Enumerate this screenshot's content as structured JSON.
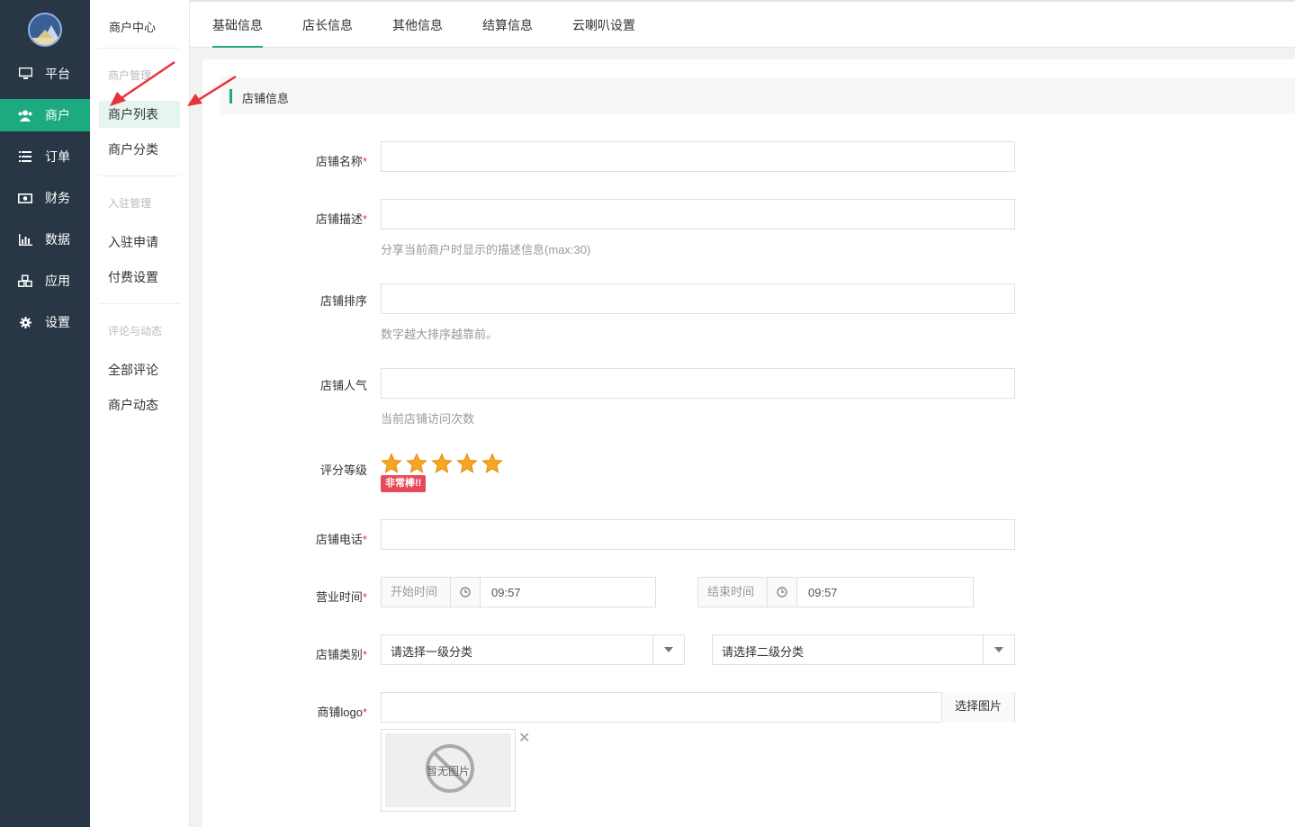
{
  "nav": [
    {
      "label": "平台",
      "icon": "monitor-icon"
    },
    {
      "label": "商户",
      "icon": "users-icon"
    },
    {
      "label": "订单",
      "icon": "list-icon"
    },
    {
      "label": "财务",
      "icon": "money-icon"
    },
    {
      "label": "数据",
      "icon": "bar-chart-icon"
    },
    {
      "label": "应用",
      "icon": "cubes-icon"
    },
    {
      "label": "设置",
      "icon": "gear-icon"
    }
  ],
  "sub": {
    "title": "商户中心",
    "group_merchant": "商户管理",
    "item_list": "商户列表",
    "item_category": "商户分类",
    "group_join": "入驻管理",
    "item_apply": "入驻申请",
    "item_fee": "付费设置",
    "group_review": "评论与动态",
    "item_comments": "全部评论",
    "item_moments": "商户动态"
  },
  "tabs": [
    "基础信息",
    "店长信息",
    "其他信息",
    "结算信息",
    "云喇叭设置"
  ],
  "section_title": "店铺信息",
  "form": {
    "name_label": "店铺名称",
    "desc_label": "店铺描述",
    "desc_help": "分享当前商户时显示的描述信息(max:30)",
    "sort_label": "店铺排序",
    "sort_help": "数字越大排序越靠前。",
    "pop_label": "店铺人气",
    "pop_help": "当前店铺访问次数",
    "rating_label": "评分等级",
    "rating_value": 5,
    "rating_max": 5,
    "rating_badge": "非常棒!!",
    "phone_label": "店铺电话",
    "hours_label": "营业时间",
    "start_label": "开始时间",
    "start_value": "09:57",
    "end_label": "结束时间",
    "end_value": "09:57",
    "category_label": "店铺类别",
    "category1_placeholder": "请选择一级分类",
    "category2_placeholder": "请选择二级分类",
    "logo_label": "商铺logo",
    "pick_image": "选择图片",
    "no_image": "暂无图片",
    "required_mark": "*"
  },
  "colors": {
    "accent": "#1bab7f",
    "sidebar": "#283645",
    "required": "#e4393c",
    "badge": "#e64a5a",
    "arrow": "#e8333c"
  }
}
